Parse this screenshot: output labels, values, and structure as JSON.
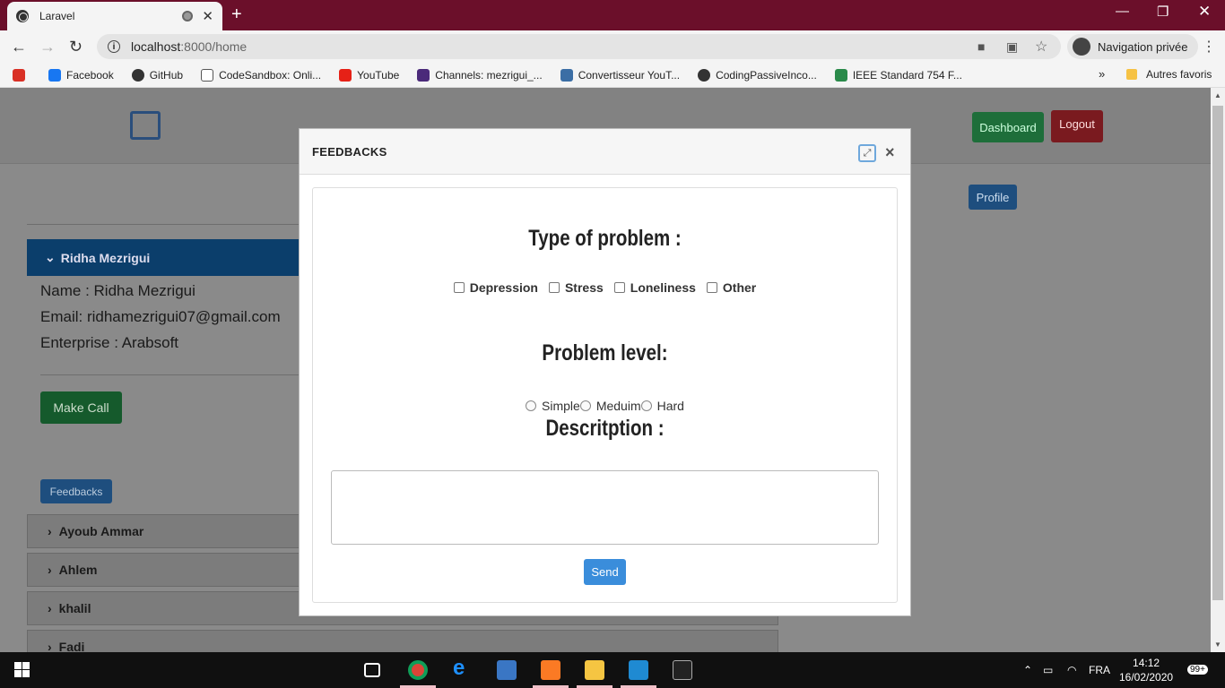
{
  "browser": {
    "tab_title": "Laravel",
    "url_host": "localhost",
    "url_rest": ":8000/home",
    "incognito_label": "Navigation privée",
    "bookmarks": [
      {
        "label": "Facebook",
        "color": "#1877f2"
      },
      {
        "label": "GitHub",
        "color": "#333333"
      },
      {
        "label": "CodeSandbox: Onli...",
        "color": "#555555"
      },
      {
        "label": "YouTube",
        "color": "#e62117"
      },
      {
        "label": "Channels: mezrigui_...",
        "color": "#4b2a7a"
      },
      {
        "label": "Convertisseur YouT...",
        "color": "#3b6ea5"
      },
      {
        "label": "CodingPassiveInco...",
        "color": "#333333"
      },
      {
        "label": "IEEE Standard 754 F...",
        "color": "#2a8a4a"
      }
    ],
    "other_bookmarks": "Autres favoris"
  },
  "navbar": {
    "dashboard": "Dashboard",
    "logout": "Logout",
    "profile": "Profile"
  },
  "user_panel": {
    "name_header": "Ridha Mezrigui",
    "name_line": "Name : Ridha Mezrigui",
    "email_line": "Email: ridhamezrigui07@gmail.com",
    "enterprise_line": "Enterprise : Arabsoft",
    "call_button": "Make Call",
    "feedbacks_button": "Feedbacks"
  },
  "accordion": [
    {
      "label": "Ayoub Ammar"
    },
    {
      "label": "Ahlem"
    },
    {
      "label": "khalil"
    },
    {
      "label": "Fadi"
    }
  ],
  "modal": {
    "title": "FEEDBACKS",
    "type_heading": "Type of problem :",
    "problem_types": [
      "Depression",
      "Stress",
      "Loneliness",
      "Other"
    ],
    "level_heading": "Problem level:",
    "levels": [
      "Simple",
      "Meduim",
      "Hard"
    ],
    "description_heading": "Descritption :",
    "send_button": "Send"
  },
  "taskbar": {
    "language": "FRA",
    "time": "14:12",
    "date": "16/02/2020",
    "notifications": "99+"
  }
}
